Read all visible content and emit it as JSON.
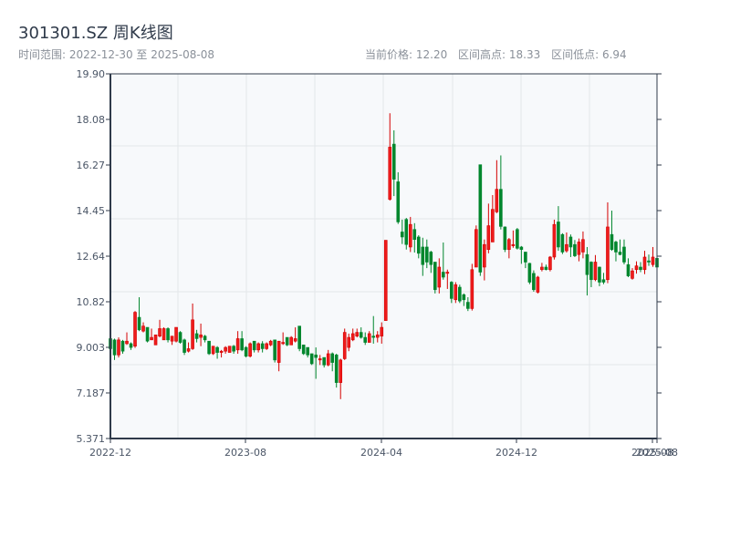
{
  "header": {
    "title": "301301.SZ 周K线图",
    "range": "时间范围: 2022-12-30 至 2025-08-08",
    "current_price": "当前价格: 12.20",
    "range_high": "区间高点: 18.33",
    "range_low": "区间低点: 6.94"
  },
  "chart_data": {
    "type": "candlestick",
    "ohlc_format": "[open, close, low, high]",
    "ylim": [
      5.371,
      19.9
    ],
    "y_ticks": [
      "5.371",
      "7.187",
      "9.003",
      "10.82",
      "12.64",
      "14.45",
      "16.27",
      "18.08",
      "19.90"
    ],
    "x_ticks": [
      "2022-12",
      "2023-08",
      "2024-04",
      "2024-12",
      "2025-08",
      "2025-08"
    ],
    "grid": true,
    "colors": {
      "up": "#d40000",
      "down": "#00862d",
      "grid": "#e3e6ea",
      "background": "#f7f9fb",
      "axis": "#2f3a4a"
    },
    "candles": [
      [
        9.35,
        8.95,
        8.8,
        11.0
      ],
      [
        9.3,
        8.7,
        8.5,
        9.35
      ],
      [
        8.7,
        9.3,
        8.6,
        9.4
      ],
      [
        9.25,
        8.85,
        8.75,
        9.3
      ],
      [
        9.15,
        9.25,
        9.1,
        9.6
      ],
      [
        9.15,
        9.0,
        8.9,
        9.2
      ],
      [
        9.05,
        10.4,
        8.98,
        10.45
      ],
      [
        10.2,
        9.7,
        9.65,
        11.0
      ],
      [
        9.65,
        9.85,
        9.6,
        10.0
      ],
      [
        9.8,
        9.25,
        9.2,
        9.8
      ],
      [
        9.3,
        9.4,
        9.3,
        9.75
      ],
      [
        9.1,
        9.5,
        9.1,
        9.5
      ],
      [
        9.45,
        9.75,
        9.4,
        10.1
      ],
      [
        9.3,
        9.75,
        9.3,
        9.8
      ],
      [
        9.75,
        9.3,
        9.2,
        9.8
      ],
      [
        9.25,
        9.45,
        9.1,
        9.45
      ],
      [
        9.25,
        9.8,
        9.2,
        9.8
      ],
      [
        9.6,
        9.2,
        9.15,
        9.65
      ],
      [
        9.3,
        8.8,
        8.7,
        9.35
      ],
      [
        8.85,
        8.95,
        8.8,
        9.2
      ],
      [
        8.95,
        10.1,
        8.9,
        10.75
      ],
      [
        9.55,
        9.35,
        9.2,
        9.7
      ],
      [
        9.4,
        9.5,
        9.05,
        9.95
      ],
      [
        9.45,
        9.3,
        9.2,
        9.5
      ],
      [
        9.25,
        8.75,
        8.7,
        9.25
      ],
      [
        8.75,
        9.05,
        8.7,
        9.05
      ],
      [
        9.0,
        8.8,
        8.55,
        9.05
      ],
      [
        8.8,
        8.85,
        8.6,
        8.9
      ],
      [
        8.85,
        9.0,
        8.75,
        9.05
      ],
      [
        8.8,
        9.05,
        8.8,
        9.05
      ],
      [
        9.05,
        8.85,
        8.75,
        9.1
      ],
      [
        8.9,
        9.35,
        8.75,
        9.65
      ],
      [
        9.35,
        8.9,
        8.85,
        9.65
      ],
      [
        9.0,
        8.65,
        8.6,
        9.05
      ],
      [
        8.65,
        9.15,
        8.6,
        9.2
      ],
      [
        9.25,
        8.9,
        8.8,
        9.25
      ],
      [
        8.9,
        9.15,
        8.8,
        9.2
      ],
      [
        9.15,
        8.95,
        8.8,
        9.25
      ],
      [
        8.95,
        9.15,
        8.9,
        9.2
      ],
      [
        9.1,
        9.25,
        9.05,
        9.3
      ],
      [
        9.3,
        8.5,
        8.4,
        9.3
      ],
      [
        8.4,
        9.25,
        8.05,
        9.25
      ],
      [
        9.15,
        9.2,
        9.1,
        9.6
      ],
      [
        9.4,
        9.1,
        9.05,
        9.4
      ],
      [
        9.1,
        9.4,
        9.1,
        9.45
      ],
      [
        9.25,
        9.35,
        9.2,
        9.8
      ],
      [
        9.85,
        8.95,
        8.85,
        9.85
      ],
      [
        9.1,
        8.75,
        8.7,
        9.1
      ],
      [
        9.0,
        8.7,
        8.6,
        9.0
      ],
      [
        8.75,
        8.35,
        8.3,
        8.75
      ],
      [
        8.7,
        8.6,
        7.75,
        9.0
      ],
      [
        8.5,
        8.55,
        8.3,
        8.7
      ],
      [
        8.6,
        8.3,
        8.2,
        8.6
      ],
      [
        8.3,
        8.75,
        8.25,
        8.9
      ],
      [
        8.75,
        8.4,
        8.05,
        8.8
      ],
      [
        8.7,
        7.6,
        7.4,
        8.75
      ],
      [
        7.6,
        8.5,
        6.94,
        8.55
      ],
      [
        8.55,
        9.6,
        8.5,
        9.75
      ],
      [
        9.0,
        9.4,
        8.85,
        9.55
      ],
      [
        9.3,
        9.55,
        9.25,
        9.75
      ],
      [
        9.45,
        9.6,
        9.4,
        9.75
      ],
      [
        9.6,
        9.4,
        9.35,
        9.8
      ],
      [
        9.4,
        9.2,
        9.1,
        9.6
      ],
      [
        9.2,
        9.55,
        9.2,
        9.65
      ],
      [
        9.45,
        9.4,
        9.15,
        10.25
      ],
      [
        9.4,
        9.5,
        9.2,
        9.65
      ],
      [
        9.45,
        9.8,
        9.15,
        10.0
      ],
      [
        10.07,
        13.27,
        10.07,
        13.27
      ],
      [
        14.9,
        16.98,
        14.85,
        18.33
      ],
      [
        17.1,
        15.7,
        15.03,
        17.65
      ],
      [
        15.6,
        14.0,
        13.92,
        15.98
      ],
      [
        13.6,
        13.4,
        13.12,
        14.09
      ],
      [
        14.1,
        13.1,
        12.9,
        14.16
      ],
      [
        13.0,
        13.9,
        12.8,
        14.2
      ],
      [
        13.7,
        13.3,
        12.78,
        13.95
      ],
      [
        13.4,
        12.75,
        12.55,
        13.47
      ],
      [
        13.0,
        12.3,
        11.85,
        13.37
      ],
      [
        13.0,
        12.4,
        12.16,
        13.3
      ],
      [
        12.8,
        12.3,
        11.97,
        12.85
      ],
      [
        12.4,
        11.3,
        11.15,
        12.4
      ],
      [
        11.4,
        12.2,
        11.15,
        12.55
      ],
      [
        12.0,
        11.8,
        11.7,
        13.18
      ],
      [
        11.95,
        12.0,
        11.33,
        12.1
      ],
      [
        11.6,
        10.95,
        10.77,
        11.64
      ],
      [
        10.9,
        11.5,
        10.77,
        11.6
      ],
      [
        11.4,
        10.85,
        10.77,
        11.5
      ],
      [
        11.1,
        10.9,
        10.65,
        11.15
      ],
      [
        10.8,
        10.55,
        10.45,
        11.0
      ],
      [
        10.55,
        12.1,
        10.47,
        12.33
      ],
      [
        12.2,
        13.7,
        12.2,
        13.86
      ],
      [
        16.28,
        12.0,
        11.85,
        16.28
      ],
      [
        12.2,
        13.1,
        11.67,
        13.3
      ],
      [
        12.9,
        13.85,
        12.75,
        14.73
      ],
      [
        13.2,
        14.5,
        13.2,
        15.07
      ],
      [
        14.4,
        15.3,
        14.35,
        16.46
      ],
      [
        15.3,
        13.82,
        13.7,
        16.65
      ],
      [
        13.8,
        12.9,
        12.8,
        13.82
      ],
      [
        12.9,
        13.3,
        12.55,
        13.36
      ],
      [
        13.05,
        13.1,
        12.97,
        13.66
      ],
      [
        13.7,
        12.95,
        12.9,
        13.76
      ],
      [
        13.0,
        12.9,
        12.33,
        13.04
      ],
      [
        12.8,
        12.4,
        12.16,
        12.8
      ],
      [
        12.35,
        11.6,
        11.52,
        12.37
      ],
      [
        11.95,
        11.3,
        11.22,
        12.07
      ],
      [
        11.2,
        11.8,
        11.15,
        11.85
      ],
      [
        12.1,
        12.2,
        12.03,
        12.37
      ],
      [
        12.2,
        12.1,
        12.07,
        12.3
      ],
      [
        12.1,
        12.6,
        12.03,
        12.64
      ],
      [
        12.6,
        13.9,
        12.5,
        14.09
      ],
      [
        14.0,
        13.0,
        12.85,
        14.63
      ],
      [
        13.5,
        12.8,
        12.72,
        13.55
      ],
      [
        12.85,
        13.1,
        12.78,
        13.58
      ],
      [
        13.4,
        13.0,
        12.6,
        13.5
      ],
      [
        13.1,
        12.65,
        12.6,
        13.28
      ],
      [
        12.7,
        13.2,
        12.43,
        13.34
      ],
      [
        12.8,
        13.3,
        12.55,
        13.62
      ],
      [
        12.7,
        11.9,
        11.07,
        13.0
      ],
      [
        12.4,
        11.7,
        11.4,
        12.43
      ],
      [
        11.7,
        12.4,
        11.64,
        12.68
      ],
      [
        12.2,
        11.6,
        11.44,
        12.22
      ],
      [
        11.7,
        11.6,
        11.52,
        11.97
      ],
      [
        11.7,
        13.8,
        11.56,
        14.78
      ],
      [
        13.5,
        12.9,
        12.85,
        14.45
      ],
      [
        13.2,
        12.8,
        12.43,
        13.25
      ],
      [
        12.8,
        12.7,
        12.67,
        13.3
      ],
      [
        13.0,
        12.4,
        12.31,
        13.3
      ],
      [
        12.3,
        11.85,
        11.8,
        12.55
      ],
      [
        11.75,
        12.05,
        11.7,
        12.16
      ],
      [
        12.1,
        12.25,
        11.94,
        12.43
      ],
      [
        12.2,
        12.1,
        12.0,
        12.4
      ],
      [
        12.1,
        12.6,
        11.92,
        12.85
      ],
      [
        12.45,
        12.4,
        12.25,
        12.7
      ],
      [
        12.3,
        12.6,
        12.21,
        13.0
      ],
      [
        12.55,
        12.2,
        12.18,
        12.85
      ]
    ]
  }
}
